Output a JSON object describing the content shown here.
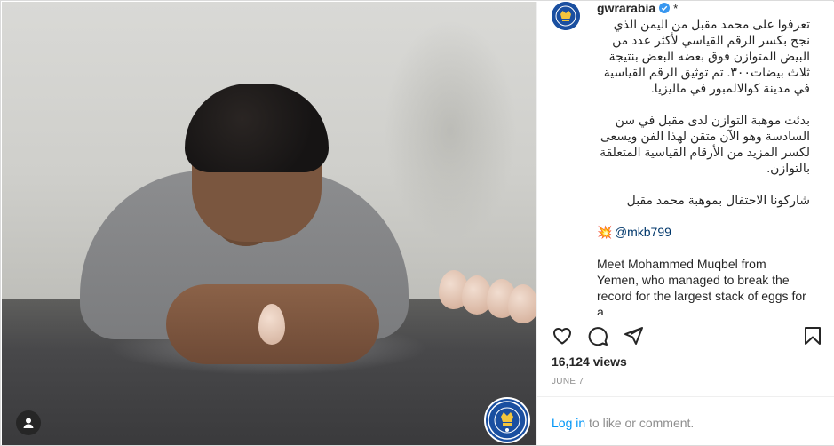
{
  "post": {
    "account": {
      "username": "gwrarabia",
      "verified": true,
      "extra_mark": "*"
    },
    "caption": {
      "paragraph_ar_1": "تعرفوا على محمد مقبل من اليمن الذي نجح بكسر الرقم القياسي لأكثر عدد من البيض المتوازن فوق بعضه البعض بنتيجة ثلاث بيضات٣٠٠. تم توثيق الرقم القياسية في مدينة كوالالمبور في ماليزيا.",
      "paragraph_ar_2": "بدئت موهبة التوازن لدى مقبل في سن السادسة وهو الآن متقن لهذا الفن ويسعى لكسر المزيد من الأرقام القياسية المتعلقة بالتوازن.",
      "paragraph_ar_3": "شاركونا الاحتفال بموهبة محمد مقبل",
      "mention_emoji": "💥",
      "mention": "@mkb799",
      "paragraph_en": "Meet Mohammed Muqbel from Yemen, who managed to break the record for the largest stack of eggs for a..."
    },
    "actions": {
      "like_icon": "heart-icon",
      "comment_icon": "comment-icon",
      "share_icon": "paper-plane-icon",
      "save_icon": "bookmark-icon"
    },
    "views": "16,124 views",
    "date": "JUNE 7",
    "login": {
      "link_text": "Log in",
      "rest_text": " to like or comment."
    }
  },
  "media": {
    "badge_icon": "guinness-world-records-badge-icon",
    "user_tag_icon": "user-tag-icon"
  },
  "colors": {
    "brand_blue": "#1a4fa0",
    "link_blue": "#0095f6",
    "text": "#262626",
    "muted": "#8e8e8e",
    "verified": "#3897f0"
  }
}
